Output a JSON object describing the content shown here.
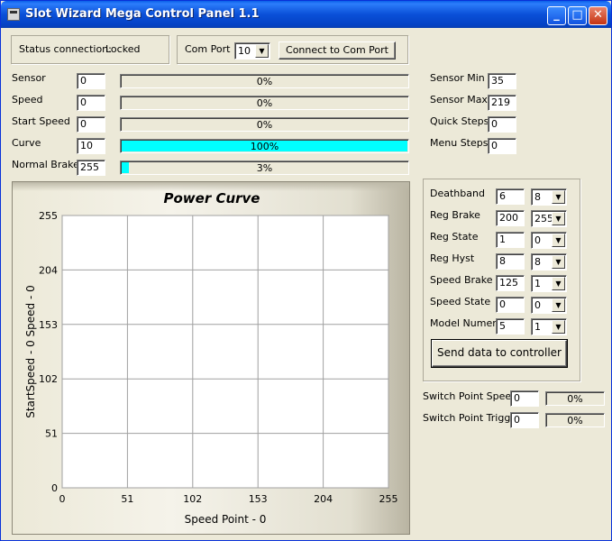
{
  "window": {
    "title": "Slot Wizard Mega Control Panel 1.1",
    "min_glyph": "_",
    "max_glyph": "□",
    "close_glyph": "✕"
  },
  "status": {
    "label": "Status connection:",
    "value": "Locked"
  },
  "comport": {
    "label": "Com Port",
    "value": "10",
    "connect_label": "Connect to Com Port"
  },
  "meters": [
    {
      "label": "Sensor",
      "value": "0",
      "percent": "0%",
      "fraction": 0
    },
    {
      "label": "Speed",
      "value": "0",
      "percent": "0%",
      "fraction": 0
    },
    {
      "label": "Start Speed",
      "value": "0",
      "percent": "0%",
      "fraction": 0
    },
    {
      "label": "Curve",
      "value": "10",
      "percent": "100%",
      "fraction": 1
    },
    {
      "label": "Normal Brake",
      "value": "255",
      "percent": "3%",
      "fraction": 0.03
    }
  ],
  "right_fields": [
    {
      "label": "Sensor Min",
      "value": "35"
    },
    {
      "label": "Sensor Max",
      "value": "219"
    },
    {
      "label": "Quick Steps",
      "value": "0"
    },
    {
      "label": "Menu Steps",
      "value": "0"
    }
  ],
  "params": [
    {
      "label": "Deathband",
      "value": "6",
      "select": "8"
    },
    {
      "label": "Reg Brake",
      "value": "200",
      "select": "255"
    },
    {
      "label": "Reg State",
      "value": "1",
      "select": "0"
    },
    {
      "label": "Reg Hyst",
      "value": "8",
      "select": "8"
    },
    {
      "label": "Speed Brake",
      "value": "125",
      "select": "1"
    },
    {
      "label": "Speed State",
      "value": "0",
      "select": "0"
    },
    {
      "label": "Model Numer",
      "value": "5",
      "select": "1"
    }
  ],
  "send_button": "Send data to controller",
  "switch_points": [
    {
      "label": "Switch Point Speed",
      "value": "0",
      "percent": "0%"
    },
    {
      "label": "Switch Point Trigger",
      "value": "0",
      "percent": "0%"
    }
  ],
  "icons": {
    "dropdown": "chevron-down-icon",
    "app": "app-icon"
  },
  "colors": {
    "progress_fill": "#00ffff",
    "title_bar": "#0a50d8"
  },
  "chart_data": {
    "type": "line",
    "title": "Power Curve",
    "xlabel": "Speed Point - 0",
    "ylabel": "StartSpeed - 0   Speed - 0",
    "xlim": [
      0,
      255
    ],
    "ylim": [
      0,
      255
    ],
    "xticks": [
      "0",
      "51",
      "102",
      "153",
      "204",
      "255"
    ],
    "yticks": [
      "0",
      "51",
      "102",
      "153",
      "204",
      "255"
    ],
    "grid": true,
    "series": []
  }
}
